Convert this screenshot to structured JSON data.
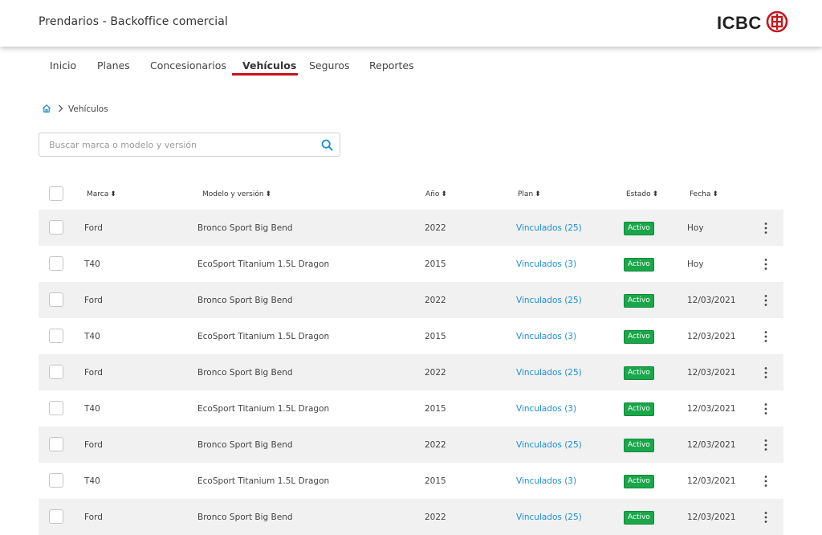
{
  "header": {
    "app_title": "Prendarios - Backoffice comercial",
    "logo_text": "ICBC",
    "logo_seal_icon": "icbc-seal-icon",
    "brand_color": "#c4161c"
  },
  "nav": {
    "tabs": [
      {
        "label": "Inicio",
        "active": false
      },
      {
        "label": "Planes",
        "active": false
      },
      {
        "label": "Concesionarios",
        "active": false
      },
      {
        "label": "Vehículos",
        "active": true
      },
      {
        "label": "Seguros",
        "active": false
      },
      {
        "label": "Reportes",
        "active": false
      }
    ]
  },
  "breadcrumb": {
    "home_icon": "home-icon",
    "separator_icon": "chevron-right-icon",
    "current": "Vehículos"
  },
  "search": {
    "placeholder": "Buscar marca o modelo y versión",
    "value": "",
    "icon": "search-icon"
  },
  "table": {
    "columns": [
      "Marca",
      "Modelo y versión",
      "Año",
      "Plan",
      "Estado",
      "Fecha"
    ],
    "sort_icon": "sort-icon",
    "row_menu_icon": "more-vertical-icon",
    "status_color": "#1aa74a",
    "link_color": "#1e8fd6",
    "rows": [
      {
        "marca": "Ford",
        "modelo": "Bronco Sport Big Bend",
        "anio": "2022",
        "plan": "Vinculados (25)",
        "estado": "Activo",
        "fecha": "Hoy"
      },
      {
        "marca": "T40",
        "modelo": "EcoSport Titanium 1.5L Dragon",
        "anio": "2015",
        "plan": "Vinculados (3)",
        "estado": "Activo",
        "fecha": "Hoy"
      },
      {
        "marca": "Ford",
        "modelo": "Bronco Sport Big Bend",
        "anio": "2022",
        "plan": "Vinculados (25)",
        "estado": "Activo",
        "fecha": "12/03/2021"
      },
      {
        "marca": "T40",
        "modelo": "EcoSport Titanium 1.5L Dragon",
        "anio": "2015",
        "plan": "Vinculados (3)",
        "estado": "Activo",
        "fecha": "12/03/2021"
      },
      {
        "marca": "Ford",
        "modelo": "Bronco Sport Big Bend",
        "anio": "2022",
        "plan": "Vinculados (25)",
        "estado": "Activo",
        "fecha": "12/03/2021"
      },
      {
        "marca": "T40",
        "modelo": "EcoSport Titanium 1.5L Dragon",
        "anio": "2015",
        "plan": "Vinculados (3)",
        "estado": "Activo",
        "fecha": "12/03/2021"
      },
      {
        "marca": "Ford",
        "modelo": "Bronco Sport Big Bend",
        "anio": "2022",
        "plan": "Vinculados (25)",
        "estado": "Activo",
        "fecha": "12/03/2021"
      },
      {
        "marca": "T40",
        "modelo": "EcoSport Titanium 1.5L Dragon",
        "anio": "2015",
        "plan": "Vinculados (3)",
        "estado": "Activo",
        "fecha": "12/03/2021"
      },
      {
        "marca": "Ford",
        "modelo": "Bronco Sport Big Bend",
        "anio": "2022",
        "plan": "Vinculados (25)",
        "estado": "Activo",
        "fecha": "12/03/2021"
      }
    ]
  }
}
